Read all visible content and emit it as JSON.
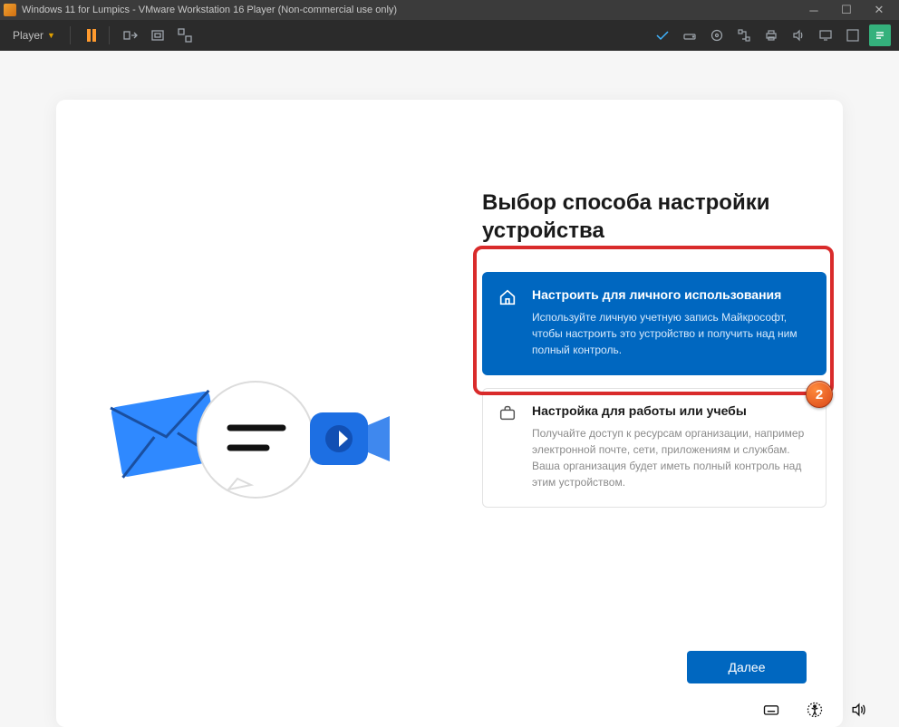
{
  "vmware": {
    "title": "Windows 11 for Lumpics - VMware Workstation 16 Player (Non-commercial use only)",
    "player_menu_label": "Player"
  },
  "setup": {
    "heading": "Выбор способа настройки устройства",
    "options": [
      {
        "title": "Настроить для личного использования",
        "desc": "Используйте личную учетную запись Майкрософт, чтобы настроить это устройство и получить над ним полный контроль."
      },
      {
        "title": "Настройка для работы или учебы",
        "desc": "Получайте доступ к ресурсам организации, например электронной почте, сети, приложениям и службам. Ваша организация будет иметь полный контроль над этим устройством."
      }
    ],
    "next_label": "Далее",
    "step_badge": "2"
  }
}
